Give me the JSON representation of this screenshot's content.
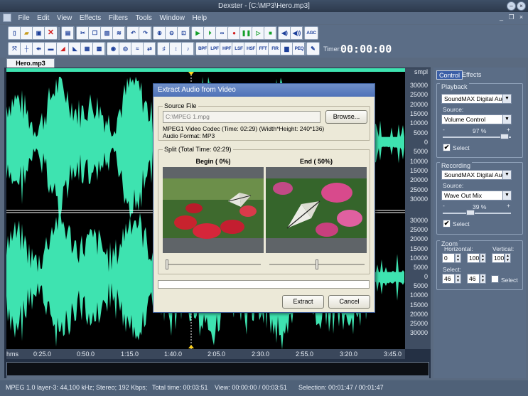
{
  "window": {
    "title": "Dexster - [C:\\MP3\\Hero.mp3]"
  },
  "menu": {
    "items": [
      "File",
      "Edit",
      "View",
      "Effects",
      "Filters",
      "Tools",
      "Window",
      "Help"
    ]
  },
  "toolbar": {
    "row1": [
      "new",
      "open",
      "save",
      "close",
      "properties",
      "cut",
      "copy",
      "paste",
      "paste-mix",
      "undo",
      "redo",
      "zoom-in",
      "zoom-out",
      "zoom-full",
      "play",
      "play-from-start",
      "loop",
      "record",
      "pause",
      "play-selection",
      "stop",
      "volume-down",
      "volume-up",
      "agc"
    ],
    "agc_label": "AGC",
    "row2_labels": [
      "BPF",
      "LPF",
      "HPF",
      "LSF",
      "HSF",
      "FFT",
      "FIR",
      "PEQ"
    ],
    "timer_label": "Timer:",
    "timer_value": "00:00:00"
  },
  "document": {
    "tab": "Hero.mp3"
  },
  "wave": {
    "scale_unit": "smpl",
    "scale_labels": [
      "30000",
      "25000",
      "20000",
      "15000",
      "10000",
      "5000",
      "0",
      "5000",
      "10000",
      "15000",
      "20000",
      "25000",
      "30000"
    ],
    "time_labels": [
      "hms",
      "0:25.0",
      "0:50.0",
      "1:15.0",
      "1:40.0",
      "2:05.0",
      "2:30.0",
      "2:55.0",
      "3:20.0",
      "3:45.0"
    ],
    "colors": {
      "wave": "#3ee3b0",
      "background": "#000000",
      "grid": "#ffffff"
    }
  },
  "right_panel": {
    "tabs": [
      "Control",
      "Effects"
    ],
    "playback": {
      "title": "Playback",
      "device": "SoundMAX Digital Audio",
      "source_label": "Source:",
      "source": "Volume Control",
      "minus": "-",
      "plus": "+",
      "volume_text": "97 %",
      "volume": 0.97,
      "select_label": "Select",
      "select_checked": "✔"
    },
    "recording": {
      "title": "Recording",
      "device": "SoundMAX Digital Audio",
      "source_label": "Source:",
      "source": "Wave Out Mix",
      "minus": "-",
      "plus": "+",
      "volume_text": "39 %",
      "volume": 0.39,
      "select_label": "Select",
      "select_checked": "✔"
    },
    "zoom": {
      "title": "Zoom",
      "horizontal_label": "Horizontal:",
      "vertical_label": "Vertical:",
      "h_min": "0",
      "h_max": "100",
      "v_value": "100",
      "select_label": "Select:",
      "sel_a": "46",
      "sel_b": "46",
      "select_check_label": "Select"
    }
  },
  "dialog": {
    "title": "Extract Audio from Video",
    "source_legend": "Source File",
    "source_path": "C:\\MPEG 1.mpg",
    "browse_label": "Browse...",
    "codec_line": "MPEG1 Video Codec (Time: 02:29) (Width*Height: 240*136)",
    "format_line": "Audio Format: MP3",
    "split_legend": "Split  (Total Time: 02:29)",
    "begin_label": "Begin ( 0%)",
    "end_label": "End ( 50%)",
    "begin_position": 0.0,
    "end_position": 0.5,
    "extract_label": "Extract",
    "cancel_label": "Cancel"
  },
  "status": {
    "format": "MPEG 1.0 layer-3: 44,100 kHz; Stereo; 192 Kbps;",
    "total_time": "Total time: 00:03:51",
    "view": "View: 00:00:00 / 00:03:51",
    "selection": "Selection: 00:01:47 / 00:01:47"
  }
}
